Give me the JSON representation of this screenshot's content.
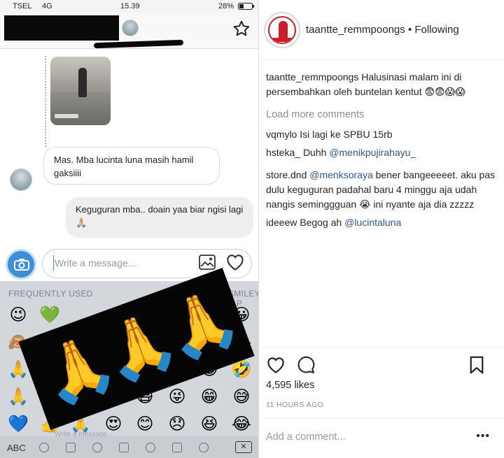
{
  "phone": {
    "status": {
      "carrier": "TSEL",
      "network": "4G",
      "time": "15.39",
      "battery": "28%"
    },
    "composer": {
      "placeholder": "Write a message..."
    },
    "messages": [
      {
        "direction": "in",
        "text": "Mas. Mba lucinta luna masih hamil gaksiiii"
      },
      {
        "direction": "out",
        "text": "Keguguran mba.. doain yaa biar ngisi lagi 🙏🏼"
      }
    ],
    "keyboard": {
      "frequently_used_label": "FREQUENTLY USED",
      "smileys_label": "SMILEYS & P",
      "abc_label": "ABC",
      "ghost_placeholder": "Write a message...",
      "emojis": [
        "😉",
        "💚",
        "🙈",
        "🙏",
        "💙",
        "😭",
        "🙏",
        "😂",
        "😜",
        "😁",
        "🤣",
        "😀",
        "😷",
        "😁",
        "😅",
        "👍",
        "😍",
        "😊",
        "😞",
        "😆",
        "😂"
      ],
      "overlay_emojis": [
        "🙏",
        "🙏",
        "🙏"
      ]
    },
    "icons": {
      "star": "star-icon",
      "camera": "camera-icon",
      "gallery": "gallery-icon",
      "heart": "heart-icon",
      "delete": "backspace-icon"
    }
  },
  "post": {
    "username": "taantte_remmpoongs",
    "bullet": "•",
    "follow_status": "Following",
    "caption": {
      "user": "taantte_remmpoongs",
      "text": "Halusinasi malam ini di persembahkan oleh buntelan kentut 😨😨😱😱"
    },
    "load_more": "Load more comments",
    "comments": [
      {
        "user": "vqmylo",
        "text": "Isi lagi ke SPBU 15rb",
        "mention": ""
      },
      {
        "user": "hsteka_",
        "text": "Duhh",
        "mention": "@menikpujirahayu_"
      },
      {
        "user": "store.dnd",
        "text": "bener bangeeeeet. aku pas dulu keguguran padahal baru 4 minggu aja udah nangis seminggguan 😭 ini nyante aja dia zzzzz",
        "mention": "@menksoraya"
      },
      {
        "user": "ideeew",
        "text": "Begog ah",
        "mention": "@lucintaluna"
      }
    ],
    "likes": "4,595 likes",
    "timestamp": "11 HOURS AGO",
    "add_comment_placeholder": "Add a comment...",
    "more": "•••"
  }
}
